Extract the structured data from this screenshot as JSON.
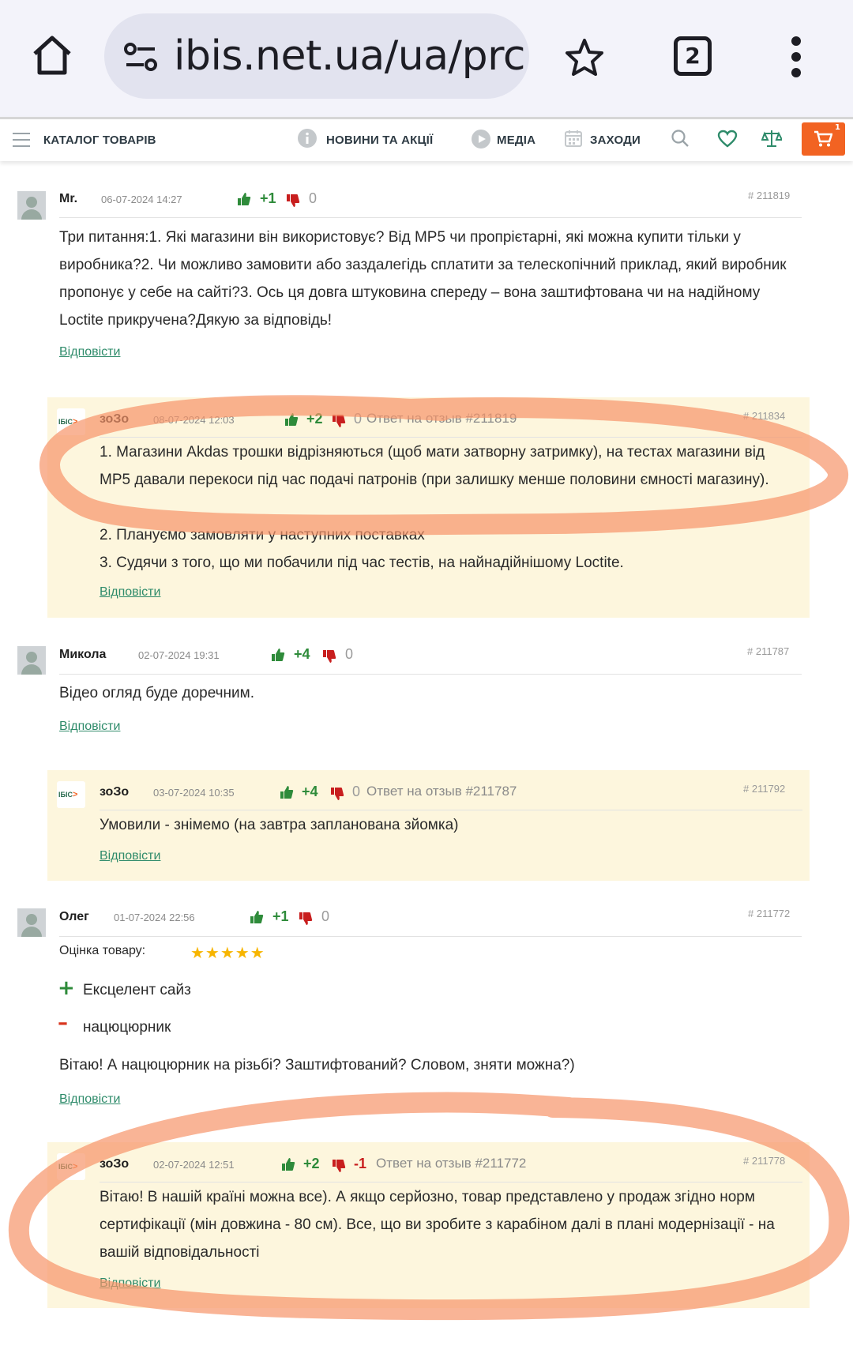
{
  "browser": {
    "url": "ibis.net.ua/ua/prc",
    "tab_count": "2"
  },
  "nav": {
    "catalog": "КАТАЛОГ ТОВАРІВ",
    "news": "НОВИНИ ТА АКЦІЇ",
    "media": "МЕДІА",
    "events": "ЗАХОДИ",
    "cart_count": "1"
  },
  "comments": [
    {
      "author": "Mr.",
      "date": "06-07-2024 14:27",
      "likes": "+1",
      "dislikes": "0",
      "id": "# 211819",
      "text": "Три питання:1. Які магазини він використовує? Від MP5 чи пропрієтарні, які можна купити тільки у виробника?2. Чи можливо замовити або заздалегідь сплатити за телескопічний приклад, який виробник пропонує у себе на сайті?3. Ось ця довга штуковина спереду – вона заштифтована чи на надійному Loctite прикручена?Дякую за відповідь!",
      "reply_label": "Відповісти",
      "reply": {
        "logo": "ІБІС",
        "author": "зоЗо",
        "date": "08-07-2024 12:03",
        "likes": "+2",
        "dislikes": "0",
        "ref": "Ответ на отзыв #211819",
        "id": "# 211834",
        "lines": [
          "1. Магазини Akdas трошки відрізняються (щоб мати затворну затримку), на тестах магазини від MP5 давали перекоси під час подачі патронів (при залишку менше половини ємності магазину).",
          "2. Плануємо замовляти у наступних поставках",
          "3. Судячи з того, що ми побачили під час тестів, на найнадійнішому Loctite."
        ],
        "reply_label": "Відповісти"
      }
    },
    {
      "author": "Микола",
      "date": "02-07-2024 19:31",
      "likes": "+4",
      "dislikes": "0",
      "id": "# 211787",
      "text": "Відео огляд буде доречним.",
      "reply_label": "Відповісти",
      "reply": {
        "logo": "ІБІС",
        "author": "зоЗо",
        "date": "03-07-2024 10:35",
        "likes": "+4",
        "dislikes": "0",
        "ref": "Ответ на отзыв #211787",
        "id": "# 211792",
        "lines": [
          "Умовили - знімемо (на завтра запланована зйомка)"
        ],
        "reply_label": "Відповісти"
      }
    },
    {
      "author": "Олег",
      "date": "01-07-2024 22:56",
      "likes": "+1",
      "dislikes": "0",
      "id": "# 211772",
      "rating_label": "Оцінка товару:",
      "rating": 5,
      "stars": "★★★★★",
      "pros": "Ексцелент сайз",
      "cons": "нацюцюрник",
      "text": "Вітаю! А нацюцюрник на різьбі? Заштифтований? Словом, зняти можна?)",
      "reply_label": "Відповісти",
      "reply": {
        "logo": "ІБІС",
        "author": "зоЗо",
        "date": "02-07-2024 12:51",
        "likes": "+2",
        "dislikes": "-1",
        "ref": "Ответ на отзыв #211772",
        "id": "# 211778",
        "lines": [
          "Вітаю! В нашій країні можна все). А якщо серйозно, товар представлено у продаж згідно норм сертифікації (мін довжина - 80 см). Все, що ви зробите з карабіном далі в плані модернізації - на вашій відповідальності"
        ],
        "reply_label": "Відповісти"
      }
    }
  ],
  "colors": {
    "brand_green": "#2e8b6a",
    "accent_orange": "#f26322",
    "reply_bg": "#fdf6dd",
    "highlight_marker": "#f7946a"
  },
  "icons": [
    "home-icon",
    "site-info-icon",
    "star-icon",
    "tabs-icon",
    "more-vert-icon",
    "hamburger-icon",
    "info-icon",
    "play-icon",
    "calendar-icon",
    "search-icon",
    "heart-icon",
    "compare-icon",
    "cart-icon",
    "thumbs-up-icon",
    "thumbs-down-icon"
  ]
}
